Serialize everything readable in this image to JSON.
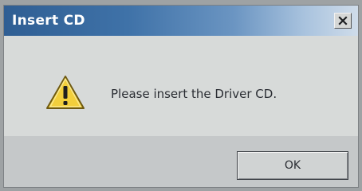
{
  "dialog": {
    "title": "Insert CD",
    "message": "Please insert the Driver CD.",
    "icon": "warning-icon",
    "ok_label": "OK",
    "close_icon": "close-icon"
  },
  "colors": {
    "titlebar_start": "#2f5e93",
    "titlebar_end": "#cfdcea",
    "warning_fill": "#f2cf3c"
  }
}
